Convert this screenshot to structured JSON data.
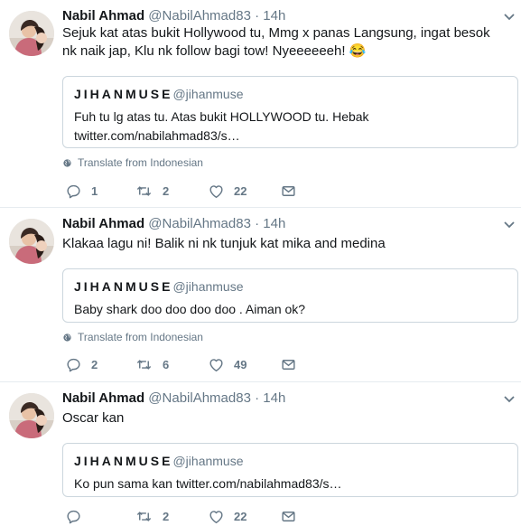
{
  "tweets": [
    {
      "name": "Nabil Ahmad",
      "handle": "@NabilAhmad83",
      "time": "14h",
      "text": "Sejuk kat atas bukit Hollywood tu, Mmg x panas Langsung, ingat besok nk naik jap, Klu nk follow bagi tow! Nyeeeeeeh! 😂",
      "quote": {
        "name": "JIHANMUSE",
        "handle": "@jihanmuse",
        "text": "Fuh tu lg atas tu. Atas bukit HOLLYWOOD tu. Hebak twitter.com/nabilahmad83/s…"
      },
      "translate": "Translate from Indonesian",
      "replies": "1",
      "retweets": "2",
      "likes": "22"
    },
    {
      "name": "Nabil Ahmad",
      "handle": "@NabilAhmad83",
      "time": "14h",
      "text": "Klakaa lagu ni! Balik ni nk tunjuk kat mika and medina",
      "quote": {
        "name": "JIHANMUSE",
        "handle": "@jihanmuse",
        "text": "Baby shark doo doo doo doo . Aiman ok?"
      },
      "translate": "Translate from Indonesian",
      "replies": "2",
      "retweets": "6",
      "likes": "49"
    },
    {
      "name": "Nabil Ahmad",
      "handle": "@NabilAhmad83",
      "time": "14h",
      "text": "Oscar kan",
      "quote": {
        "name": "JIHANMUSE",
        "handle": "@jihanmuse",
        "text": "Ko pun sama kan twitter.com/nabilahmad83/s…"
      },
      "retweets": "2",
      "likes": "22"
    }
  ],
  "dot": "·",
  "colors": {
    "text": "#14171a",
    "muted": "#657786",
    "border": "#e6ecf0",
    "quote_border": "#ccd6dd"
  }
}
